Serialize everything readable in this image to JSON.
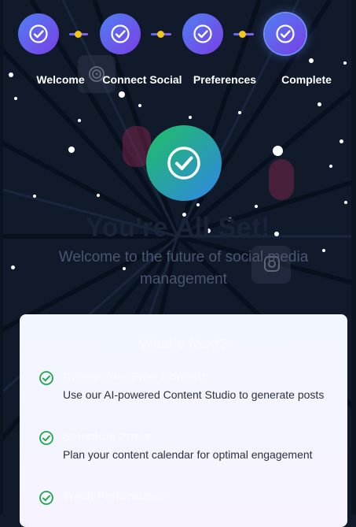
{
  "steps": [
    {
      "label": "Welcome",
      "status": "done"
    },
    {
      "label": "Connect Social",
      "status": "done"
    },
    {
      "label": "Preferences",
      "status": "done"
    },
    {
      "label": "Complete",
      "status": "current"
    }
  ],
  "hero": {
    "icon": "check-circle-icon",
    "title": "You're All Set!",
    "subtitle": "Welcome to the future of social media management"
  },
  "next": {
    "title": "What's Next?",
    "items": [
      {
        "title": "Create Your First Content",
        "description": "Use our AI-powered Content Studio to generate posts"
      },
      {
        "title": "Schedule Posts",
        "description": "Plan your content calendar for optimal engagement"
      },
      {
        "title": "Track Performance",
        "description": ""
      }
    ]
  },
  "colors": {
    "background": "#111a2b",
    "step_gradient_start": "#4f7ff2",
    "step_gradient_end": "#7b3ee6",
    "connector_dot": "#f5c518",
    "hero_gradient_start": "#1fbf63",
    "hero_gradient_end": "#2f86e6",
    "check_green": "#1fa64a"
  }
}
